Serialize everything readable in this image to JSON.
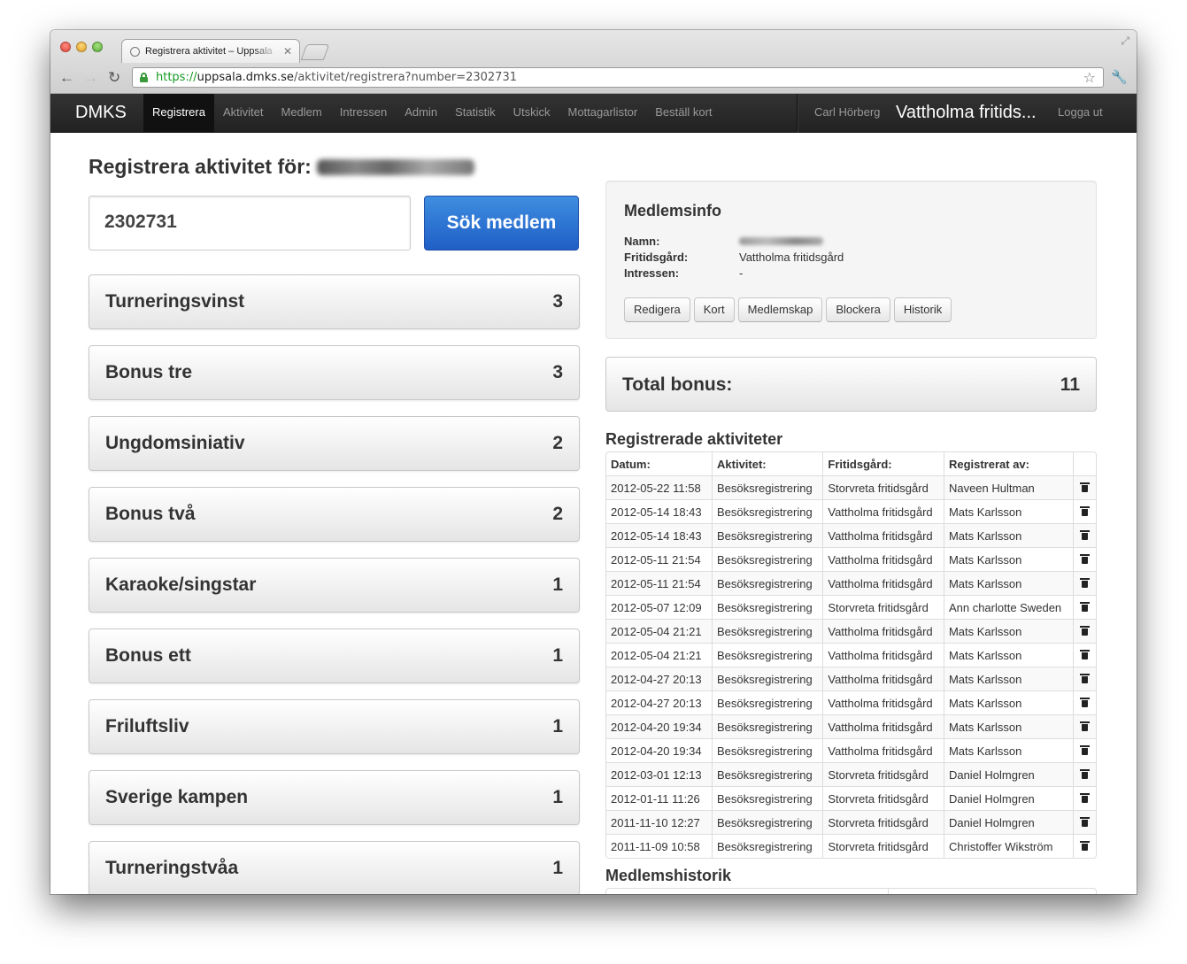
{
  "browser": {
    "tab_title": "Registrera aktivitet – Uppsala",
    "url_scheme": "https://",
    "url_host": "uppsala.dmks.se",
    "url_path": "/aktivitet/registrera?number=2302731",
    "close_glyph": "✕",
    "back_glyph": "←",
    "forward_glyph": "→",
    "reload_glyph": "↻",
    "star_glyph": "☆",
    "wrench_glyph": "🔧",
    "fullscreen_glyph": "⤢"
  },
  "navbar": {
    "brand": "DMKS",
    "links": [
      {
        "label": "Registrera",
        "active": true
      },
      {
        "label": "Aktivitet"
      },
      {
        "label": "Medlem"
      },
      {
        "label": "Intressen"
      },
      {
        "label": "Admin"
      },
      {
        "label": "Statistik"
      },
      {
        "label": "Utskick"
      },
      {
        "label": "Mottagarlistor"
      },
      {
        "label": "Beställ kort"
      }
    ],
    "user": "Carl Hörberg",
    "center_title": "Vattholma fritids...",
    "logout": "Logga ut"
  },
  "page": {
    "title": "Registrera aktivitet för:",
    "member_number": "2302731",
    "search_button": "Sök medlem"
  },
  "activities": [
    {
      "label": "Turneringsvinst",
      "count": "3"
    },
    {
      "label": "Bonus tre",
      "count": "3"
    },
    {
      "label": "Ungdomsiniativ",
      "count": "2"
    },
    {
      "label": "Bonus två",
      "count": "2"
    },
    {
      "label": "Karaoke/singstar",
      "count": "1"
    },
    {
      "label": "Bonus ett",
      "count": "1"
    },
    {
      "label": "Friluftsliv",
      "count": "1"
    },
    {
      "label": "Sverige kampen",
      "count": "1"
    },
    {
      "label": "Turneringstvåa",
      "count": "1"
    }
  ],
  "memberinfo": {
    "heading": "Medlemsinfo",
    "name_label": "Namn:",
    "club_label": "Fritidsgård:",
    "club_value": "Vattholma fritidsgård",
    "interests_label": "Intressen:",
    "interests_value": "-",
    "buttons": [
      "Redigera",
      "Kort",
      "Medlemskap",
      "Blockera",
      "Historik"
    ]
  },
  "total": {
    "label": "Total bonus:",
    "value": "11"
  },
  "registered": {
    "heading": "Registrerade aktiviteter",
    "columns": [
      "Datum:",
      "Aktivitet:",
      "Fritidsgård:",
      "Registrerat av:"
    ],
    "rows": [
      [
        "2012-05-22 11:58",
        "Besöksregistrering",
        "Storvreta fritidsgård",
        "Naveen Hultman"
      ],
      [
        "2012-05-14 18:43",
        "Besöksregistrering",
        "Vattholma fritidsgård",
        "Mats Karlsson"
      ],
      [
        "2012-05-14 18:43",
        "Besöksregistrering",
        "Vattholma fritidsgård",
        "Mats Karlsson"
      ],
      [
        "2012-05-11 21:54",
        "Besöksregistrering",
        "Vattholma fritidsgård",
        "Mats Karlsson"
      ],
      [
        "2012-05-11 21:54",
        "Besöksregistrering",
        "Vattholma fritidsgård",
        "Mats Karlsson"
      ],
      [
        "2012-05-07 12:09",
        "Besöksregistrering",
        "Storvreta fritidsgård",
        "Ann charlotte Sweden"
      ],
      [
        "2012-05-04 21:21",
        "Besöksregistrering",
        "Vattholma fritidsgård",
        "Mats Karlsson"
      ],
      [
        "2012-05-04 21:21",
        "Besöksregistrering",
        "Vattholma fritidsgård",
        "Mats Karlsson"
      ],
      [
        "2012-04-27 20:13",
        "Besöksregistrering",
        "Vattholma fritidsgård",
        "Mats Karlsson"
      ],
      [
        "2012-04-27 20:13",
        "Besöksregistrering",
        "Vattholma fritidsgård",
        "Mats Karlsson"
      ],
      [
        "2012-04-20 19:34",
        "Besöksregistrering",
        "Vattholma fritidsgård",
        "Mats Karlsson"
      ],
      [
        "2012-04-20 19:34",
        "Besöksregistrering",
        "Vattholma fritidsgård",
        "Mats Karlsson"
      ],
      [
        "2012-03-01 12:13",
        "Besöksregistrering",
        "Storvreta fritidsgård",
        "Daniel Holmgren"
      ],
      [
        "2012-01-11 11:26",
        "Besöksregistrering",
        "Storvreta fritidsgård",
        "Daniel Holmgren"
      ],
      [
        "2011-11-10 12:27",
        "Besöksregistrering",
        "Storvreta fritidsgård",
        "Daniel Holmgren"
      ],
      [
        "2011-11-09 10:58",
        "Besöksregistrering",
        "Storvreta fritidsgård",
        "Christoffer Wikström"
      ]
    ]
  },
  "history": {
    "heading": "Medlemshistorik"
  }
}
